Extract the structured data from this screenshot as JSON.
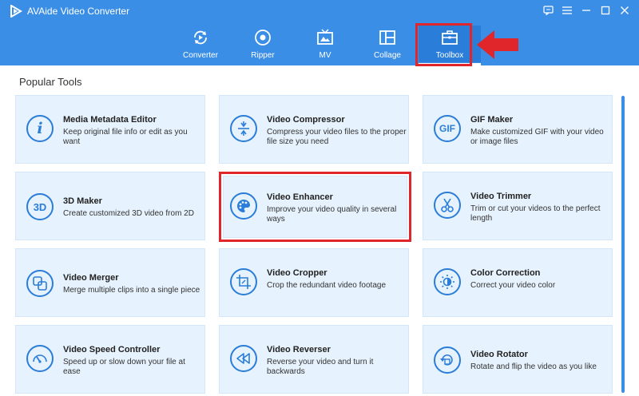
{
  "app": {
    "title": "AVAide Video Converter"
  },
  "nav": [
    {
      "key": "converter",
      "label": "Converter",
      "active": false
    },
    {
      "key": "ripper",
      "label": "Ripper",
      "active": false
    },
    {
      "key": "mv",
      "label": "MV",
      "active": false
    },
    {
      "key": "collage",
      "label": "Collage",
      "active": false
    },
    {
      "key": "toolbox",
      "label": "Toolbox",
      "active": true
    }
  ],
  "section": {
    "title": "Popular Tools"
  },
  "tools": [
    {
      "title": "Media Metadata Editor",
      "desc": "Keep original file info or edit as you want",
      "icon": "info-icon"
    },
    {
      "title": "Video Compressor",
      "desc": "Compress your video files to the proper file size you need",
      "icon": "compress-icon"
    },
    {
      "title": "GIF Maker",
      "desc": "Make customized GIF with your video or image files",
      "icon": "gif-icon"
    },
    {
      "title": "3D Maker",
      "desc": "Create customized 3D video from 2D",
      "icon": "3d-icon"
    },
    {
      "title": "Video Enhancer",
      "desc": "Improve your video quality in several ways",
      "icon": "palette-icon"
    },
    {
      "title": "Video Trimmer",
      "desc": "Trim or cut your videos to the perfect length",
      "icon": "scissors-icon"
    },
    {
      "title": "Video Merger",
      "desc": "Merge multiple clips into a single piece",
      "icon": "merge-icon"
    },
    {
      "title": "Video Cropper",
      "desc": "Crop the redundant video footage",
      "icon": "crop-icon"
    },
    {
      "title": "Color Correction",
      "desc": "Correct your video color",
      "icon": "color-icon"
    },
    {
      "title": "Video Speed Controller",
      "desc": "Speed up or slow down your file at ease",
      "icon": "speedometer-icon"
    },
    {
      "title": "Video Reverser",
      "desc": "Reverse your video and turn it backwards",
      "icon": "rewind-icon"
    },
    {
      "title": "Video Rotator",
      "desc": "Rotate and flip the video as you like",
      "icon": "rotate-icon"
    }
  ],
  "colors": {
    "header": "#3b8ee6",
    "card": "#e6f2fd",
    "accent": "#2a7dd8",
    "highlight": "#e0262b"
  }
}
